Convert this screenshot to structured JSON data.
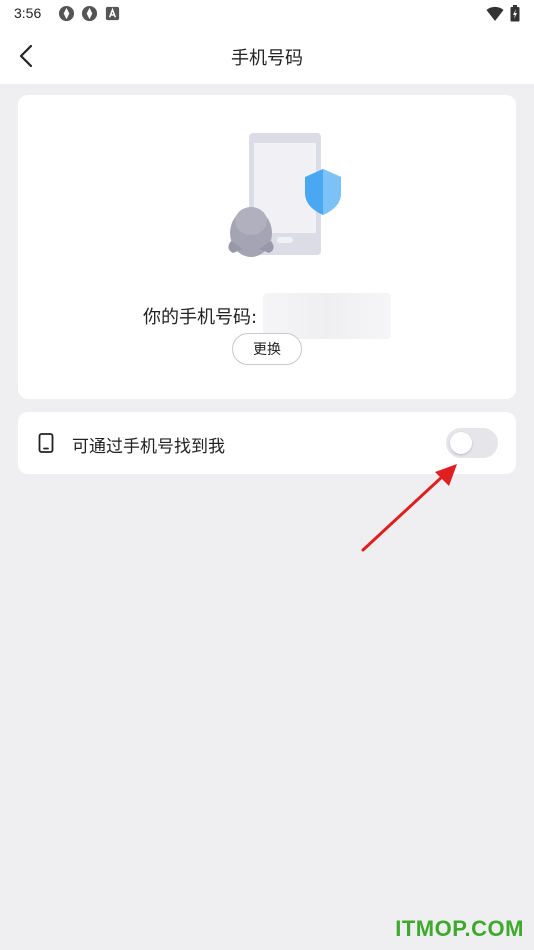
{
  "status_bar": {
    "time": "3:56",
    "icons": [
      "app-icon",
      "app-icon",
      "notification-a-icon"
    ],
    "right_icons": [
      "wifi-icon",
      "battery-icon"
    ]
  },
  "nav": {
    "back_icon": "chevron-left-icon",
    "title": "手机号码"
  },
  "phone_card": {
    "illustration": "phone-shield-penguin-illustration",
    "label": "你的手机号码:",
    "change_label": "更换"
  },
  "setting": {
    "icon": "mobile-phone-icon",
    "label": "可通过手机号找到我",
    "toggle_on": false
  },
  "colors": {
    "background": "#efeff2",
    "card": "#ffffff",
    "shield": "#4aa8f2",
    "arrow": "#e02020",
    "watermark": "#3fa92c"
  },
  "watermark": "ITMOP.COM"
}
